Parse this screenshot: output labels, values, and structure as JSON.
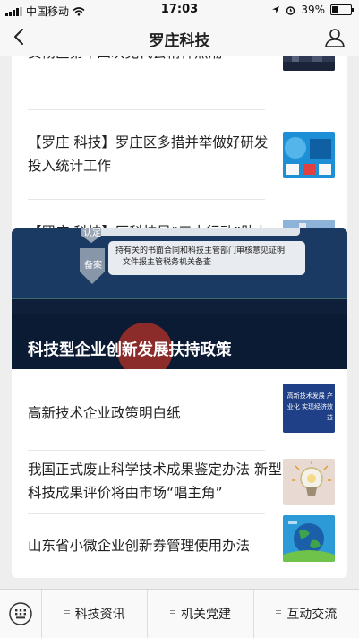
{
  "status": {
    "carrier": "中国移动",
    "time": "17:03",
    "battery": "39%",
    "battery_level": 0.39
  },
  "nav": {
    "title": "罗庄科技"
  },
  "articles_top": [
    {
      "title": "贯彻区第十四次党代会精神热潮"
    },
    {
      "title": "【罗庄 科技】罗庄区多措并举做好研发投入统计工作"
    },
    {
      "title": "【罗庄 科技】区科技局“三大行动”助力企业创新发展"
    }
  ],
  "banner": {
    "caption": "科技型企业创新发展扶持政策",
    "box_line1": "持有关的书面合同和科技主管部门审核意见证明",
    "box_line2": "文件报主管税务机关备查",
    "badge_top": "认定",
    "badge_side": "备案"
  },
  "articles_policy": [
    {
      "title": "高新技术企业政策明白纸",
      "thumb_text": "高新技术发展 产业化 实现经济效益"
    },
    {
      "title": "我国正式废止科学技术成果鉴定办法 新型科技成果评价将由市场“唱主角”"
    },
    {
      "title": "山东省小微企业创新券管理使用办法"
    }
  ],
  "tabs": [
    "科技资讯",
    "机关党建",
    "互动交流"
  ]
}
